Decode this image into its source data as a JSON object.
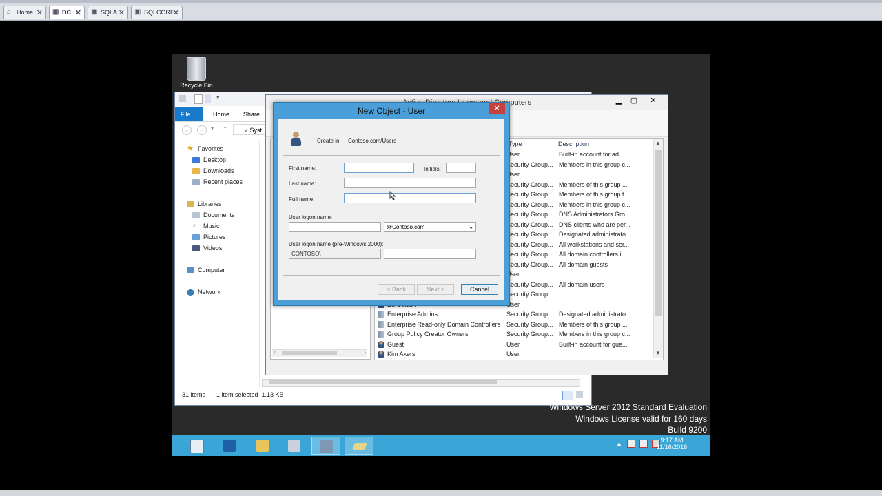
{
  "host_tabs": [
    {
      "label": "Home",
      "icon": "home-icon"
    },
    {
      "label": "DC",
      "icon": "vm-icon",
      "active": true
    },
    {
      "label": "SQLA",
      "icon": "vm-icon"
    },
    {
      "label": "SQLCORE",
      "icon": "vm-icon"
    }
  ],
  "desktop": {
    "recycle_bin_label": "Recycle Bin"
  },
  "explorer": {
    "ribbon_tabs": [
      "File",
      "Home",
      "Share"
    ],
    "address": "« Syst",
    "nav": {
      "favorites": "Favorites",
      "desktop": "Desktop",
      "downloads": "Downloads",
      "recent": "Recent places",
      "libraries": "Libraries",
      "documents": "Documents",
      "music": "Music",
      "pictures": "Pictures",
      "videos": "Videos",
      "computer": "Computer",
      "network": "Network"
    },
    "status_items": "31 items",
    "status_selected": "1 item selected  1.13 KB"
  },
  "aduc": {
    "title": "Active Directory Users and Computers",
    "columns": {
      "type": "Type",
      "description": "Description"
    },
    "rows": [
      {
        "name": "",
        "type": "User",
        "description": "Built-in account for ad..."
      },
      {
        "name": "",
        "type": "Security Group...",
        "description": "Members in this group c..."
      },
      {
        "name": "",
        "type": "User",
        "description": ""
      },
      {
        "name": "",
        "type": "Security Group...",
        "description": "Members of this group ..."
      },
      {
        "name": "",
        "type": "Security Group...",
        "description": "Members of this group t..."
      },
      {
        "name": "",
        "type": "Security Group...",
        "description": "Members in this group c..."
      },
      {
        "name": "",
        "type": "Security Group...",
        "description": "DNS Administrators Gro..."
      },
      {
        "name": "",
        "type": "Security Group...",
        "description": "DNS clients who are per..."
      },
      {
        "name": "",
        "type": "Security Group...",
        "description": "Designated administrato..."
      },
      {
        "name": "",
        "type": "Security Group...",
        "description": "All workstations and ser..."
      },
      {
        "name": "",
        "type": "Security Group...",
        "description": "All domain controllers i..."
      },
      {
        "name": "",
        "type": "Security Group...",
        "description": "All domain guests"
      },
      {
        "name": "",
        "type": "User",
        "description": ""
      },
      {
        "name": "",
        "type": "Security Group...",
        "description": "All domain users"
      },
      {
        "name": "",
        "type": "Security Group...",
        "description": ""
      },
      {
        "name": "Ed Cowan",
        "type": "User",
        "description": ""
      },
      {
        "name": "Enterprise Admins",
        "type": "Security Group...",
        "description": "Designated administrato..."
      },
      {
        "name": "Enterprise Read-only Domain Controllers",
        "type": "Security Group...",
        "description": "Members of this group ..."
      },
      {
        "name": "Group Policy Creator Owners",
        "type": "Security Group...",
        "description": "Members in this group c..."
      },
      {
        "name": "Guest",
        "type": "User",
        "description": "Built-in account for gue..."
      },
      {
        "name": "Kim Akers",
        "type": "User",
        "description": ""
      }
    ]
  },
  "dialog": {
    "title": "New Object - User",
    "create_in_label": "Create in:",
    "create_in_value": "Contoso.com/Users",
    "first_name_label": "First name:",
    "first_name_value": "",
    "initials_label": "Initials:",
    "initials_value": "",
    "last_name_label": "Last name:",
    "last_name_value": "",
    "full_name_label": "Full name:",
    "full_name_value": "",
    "logon_label": "User logon name:",
    "logon_value": "",
    "domain_suffix": "@Contoso.com",
    "pre2000_label": "User logon name (pre-Windows 2000):",
    "pre2000_domain": "CONTOSO\\",
    "pre2000_value": "",
    "back_button": "< Back",
    "next_button": "Next >",
    "cancel_button": "Cancel"
  },
  "watermark": {
    "line1": "Windows Server 2012 Standard Evaluation",
    "line2": "Windows License valid for 160 days",
    "line3": "Build 9200"
  },
  "taskbar": {
    "time": "9:17 AM",
    "date": "11/16/2016",
    "apps": [
      "server-manager-icon",
      "powershell-icon",
      "file-explorer-icon",
      "tools-icon",
      "aduc-icon",
      "eraser-icon"
    ]
  },
  "colors": {
    "taskbar": "#3aa6d8",
    "dialog_frame": "#4a9fd8",
    "close_button": "#c7403a",
    "file_tab": "#1979ca",
    "desktop": "#2a2a2a"
  }
}
